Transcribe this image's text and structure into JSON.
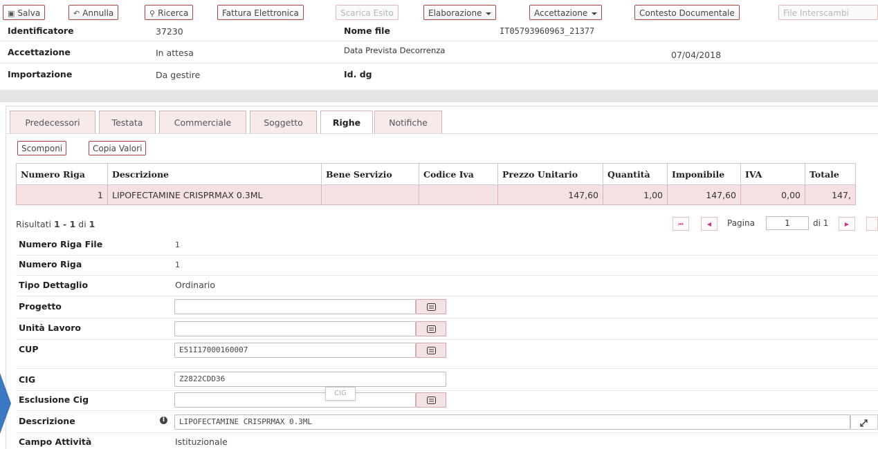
{
  "toolbar": {
    "salva": "Salva",
    "annulla": "Annulla",
    "ricerca": "Ricerca",
    "fattura": "Fattura Elettronica",
    "scarica": "Scarica Esito",
    "elaborazione": "Elaborazione",
    "accettazione": "Accettazione",
    "contesto": "Contesto Documentale",
    "file_interscambio": "File Interscambi"
  },
  "header": {
    "identificatore_label": "Identificatore",
    "identificatore_value": "37230",
    "nome_file_label": "Nome file",
    "nome_file_value": "IT05793960963_21377",
    "accettazione_label": "Accettazione",
    "accettazione_value": "In attesa",
    "data_prevista_label": "Data Prevista Decorrenza",
    "data_prevista_value": "07/04/2018",
    "importazione_label": "Importazione",
    "importazione_value": "Da gestire",
    "id_dg_label": "Id. dg"
  },
  "tabs": [
    "Predecessori",
    "Testata",
    "Commerciale",
    "Soggetto",
    "Righe",
    "Notifiche"
  ],
  "active_tab": "Righe",
  "righe_buttons": {
    "scomponi": "Scomponi",
    "copia": "Copia Valori"
  },
  "grid": {
    "columns": [
      "Numero Riga",
      "Descrizione",
      "Bene Servizio",
      "Codice Iva",
      "Prezzo Unitario",
      "Quantità",
      "Imponibile",
      "IVA",
      "Totale"
    ],
    "row": {
      "numero": "1",
      "descrizione": "LIPOFECTAMINE CRISPRMAX 0.3ML",
      "bene": "",
      "codice_iva": "",
      "prezzo": "147,60",
      "quantita": "1,00",
      "imponibile": "147,60",
      "iva": "0,00",
      "totale": "147,"
    }
  },
  "results": {
    "prefix": "Risultati ",
    "from": "1",
    "dash": " - ",
    "to": "1",
    "di": " di ",
    "total": "1"
  },
  "pager": {
    "pagina_label": "Pagina",
    "page": "1",
    "of_label": "di 1"
  },
  "detail": {
    "numero_riga_file_label": "Numero Riga File",
    "numero_riga_file_value": "1",
    "numero_riga_label": "Numero Riga",
    "numero_riga_value": "1",
    "tipo_dettaglio_label": "Tipo Dettaglio",
    "tipo_dettaglio_value": "Ordinario",
    "progetto_label": "Progetto",
    "progetto_value": "",
    "unita_label": "Unità Lavoro",
    "unita_value": "",
    "cup_label": "CUP",
    "cup_value": "E51I17000160007",
    "cig_label": "CIG",
    "cig_value": "Z2822CDD36",
    "esclusione_label": "Esclusione Cig",
    "esclusione_value": "",
    "tooltip": "CIG",
    "descrizione_label": "Descrizione",
    "descrizione_value": "LIPOFECTAMINE CRISPRMAX 0.3ML",
    "campo_label": "Campo Attività",
    "campo_value": "Istituzionale"
  },
  "colors": {
    "accent_border": "#a94442",
    "row_bg": "#f5e1e1",
    "arrow": "#3b78c2"
  }
}
